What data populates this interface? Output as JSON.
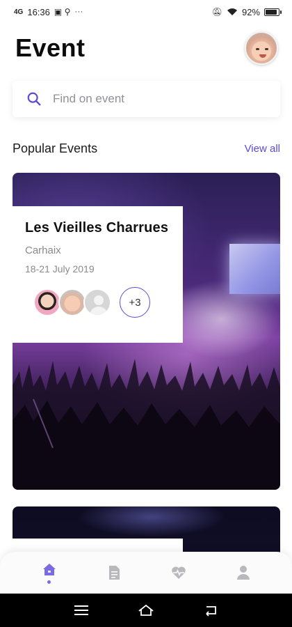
{
  "status_bar": {
    "time": "16:36",
    "signal_label": "4G",
    "extra": "···",
    "battery_percent": "92%",
    "battery_level": 0.92
  },
  "header": {
    "title": "Event"
  },
  "search": {
    "placeholder": "Find on event",
    "value": ""
  },
  "popular": {
    "section_title": "Popular Events",
    "view_all_label": "View all"
  },
  "events": [
    {
      "name": "Les Vieilles Charrues",
      "location": "Carhaix",
      "dates": "18-21 July 2019",
      "more_attendees": "+3"
    }
  ],
  "bottom_nav": {
    "items": [
      "home-icon",
      "document-icon",
      "heart-pulse-icon",
      "person-icon"
    ],
    "active": "home-icon"
  },
  "colors": {
    "accent": "#5b4ad6",
    "nav_active": "#7b6be0",
    "nav_inactive": "#b9b9bd"
  }
}
